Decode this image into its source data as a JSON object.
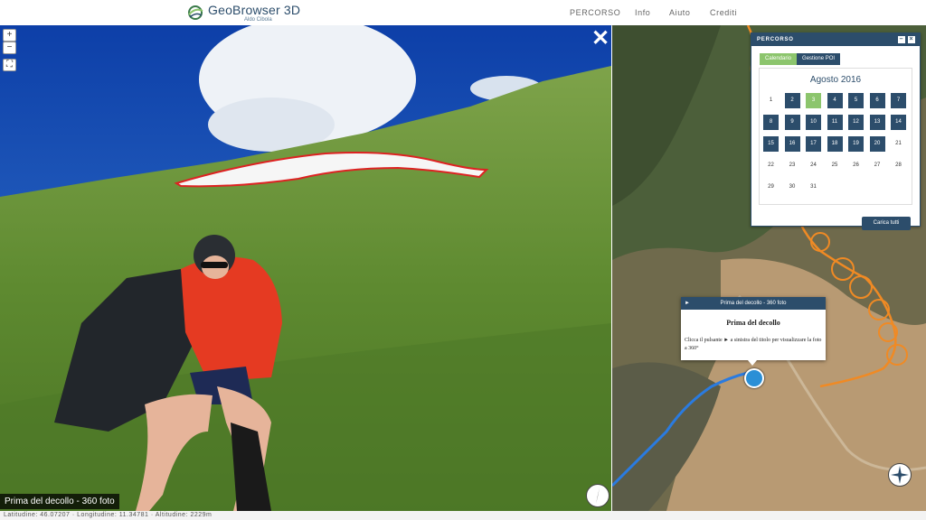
{
  "header": {
    "logo_title": "GeoBrowser 3D",
    "logo_sub": "Aldo Cibola",
    "nav": [
      "PERCORSO",
      "Info",
      "Aiuto",
      "Crediti"
    ]
  },
  "viewer": {
    "zoom_in": "+",
    "zoom_out": "−",
    "fullscreen": "⛶",
    "close": "✕",
    "caption": "Prima del decollo - 360 foto"
  },
  "status_bar": {
    "text": "Latitudine: 46.07207 · Longitudine: 11.34781 · Altitudine: 2229m"
  },
  "panel": {
    "title": "PERCORSO",
    "minimize": "–",
    "close": "×",
    "tabs": [
      "Calendario",
      "Gestione POI"
    ],
    "month": "Agosto 2016",
    "selected_day": 3,
    "loaded_days": [
      2,
      4,
      5,
      6,
      7,
      8,
      9,
      10,
      11,
      12,
      13,
      14,
      15,
      16,
      17,
      18,
      19,
      20
    ],
    "days": [
      [
        1,
        2,
        3,
        4,
        5,
        6,
        7
      ],
      [
        8,
        9,
        10,
        11,
        12,
        13,
        14
      ],
      [
        15,
        16,
        17,
        18,
        19,
        20,
        21
      ],
      [
        22,
        23,
        24,
        25,
        26,
        27,
        28
      ],
      [
        29,
        30,
        31
      ]
    ],
    "load_all": "Carica tutti"
  },
  "popup": {
    "play": "►",
    "header": "Prima del decollo - 360 foto",
    "title": "Prima del decollo",
    "body": "Clicca il pulsante ► a sinistra del titolo per visualizzare la foto a 360°"
  },
  "colors": {
    "brand": "#2c4d6b",
    "accent": "#8cc56d",
    "track_orange": "#f08a24",
    "track_blue": "#2a7be0"
  }
}
